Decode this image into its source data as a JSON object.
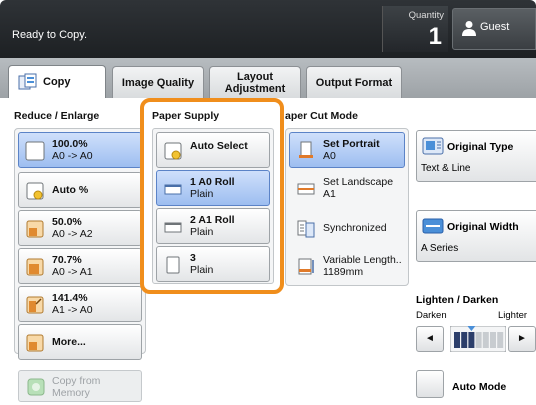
{
  "status": {
    "message": "Ready to Copy."
  },
  "quantity": {
    "label": "Quantity",
    "value": "1"
  },
  "user": {
    "label": "Guest"
  },
  "tabs": [
    {
      "label": "Copy"
    },
    {
      "label": "Image Quality"
    },
    {
      "label": "Layout Adjustment"
    },
    {
      "label": "Output Format"
    }
  ],
  "reduce_enlarge": {
    "label": "Reduce / Enlarge",
    "items": [
      {
        "line1": "100.0%",
        "line2": "A0 -> A0"
      },
      {
        "line1": "Auto %"
      },
      {
        "line1": "50.0%",
        "line2": "A0 -> A2"
      },
      {
        "line1": "70.7%",
        "line2": "A0 -> A1"
      },
      {
        "line1": "141.4%",
        "line2": "A1 -> A0"
      },
      {
        "line1": "More..."
      }
    ]
  },
  "paper_supply": {
    "label": "Paper Supply",
    "items": [
      {
        "line1": "Auto Select"
      },
      {
        "line1": "1 A0 Roll",
        "line2": "Plain"
      },
      {
        "line1": "2 A1 Roll",
        "line2": "Plain"
      },
      {
        "line1": "3",
        "line2": "Plain"
      }
    ]
  },
  "paper_cut": {
    "label": "aper Cut Mode",
    "items": [
      {
        "line1": "Set Portrait",
        "line2": "A0"
      },
      {
        "line1": "Set Landscape",
        "line2": "A1"
      },
      {
        "line1": "Synchronized"
      },
      {
        "line1": "Variable Length..",
        "line2": "1189mm"
      }
    ]
  },
  "original_type": {
    "label": "Original Type",
    "value": "Text & Line"
  },
  "original_width": {
    "label": "Original Width",
    "value": "A Series"
  },
  "density": {
    "label": "Lighten / Darken",
    "darken": "Darken",
    "lighter": "Lighter",
    "left_arrow": "◄",
    "right_arrow": "►",
    "level": 0.33
  },
  "auto_mode": {
    "label": "Auto Mode"
  },
  "copy_from_memory": {
    "label": "Copy from Memory"
  },
  "colors": {
    "highlight": "#f08e1c",
    "selected_fill": "#9dbef0",
    "status_bar": "#2a2d31"
  }
}
